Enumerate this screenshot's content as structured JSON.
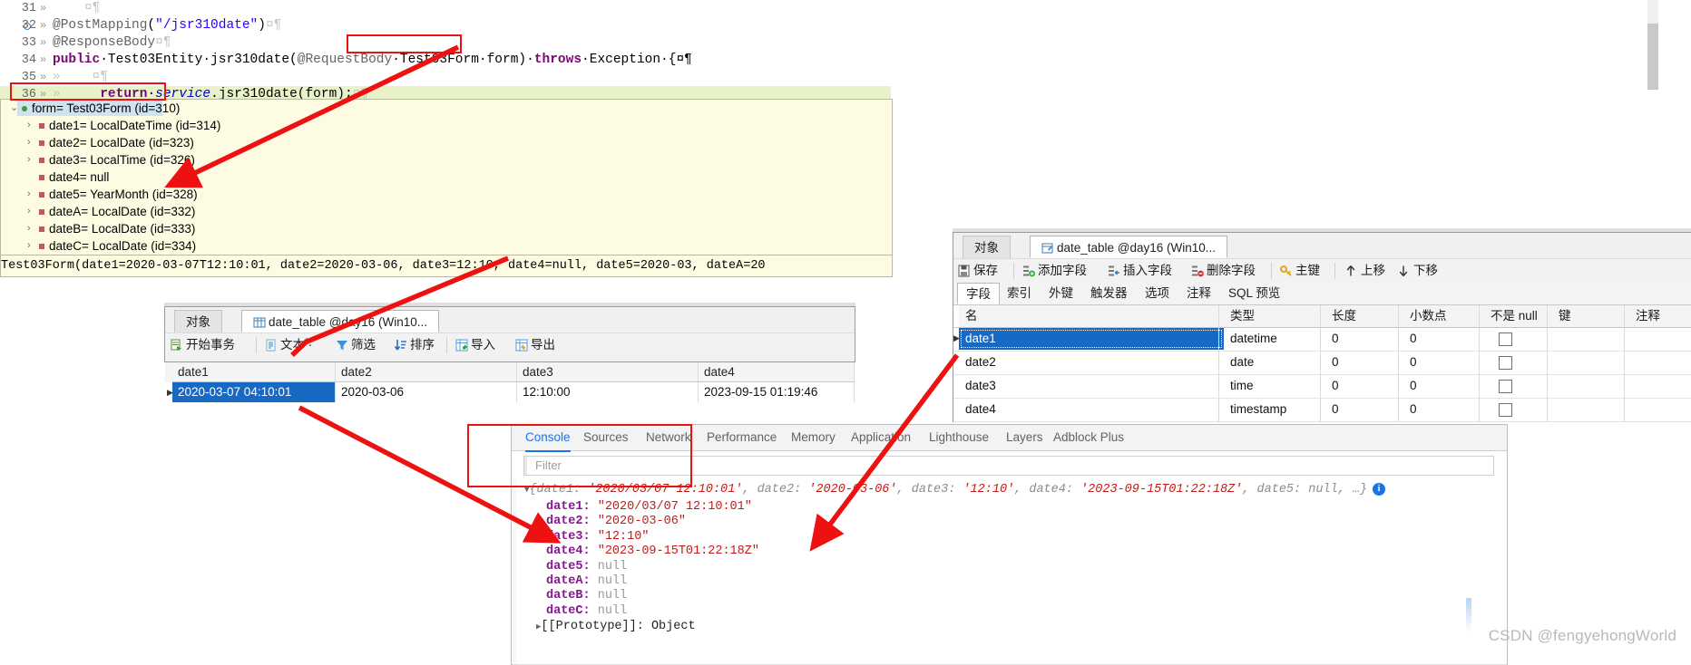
{
  "editor": {
    "lines": [
      {
        "num": "31",
        "fold": "»",
        "segments": [
          {
            "t": "    ",
            "c": "ws"
          },
          {
            "t": "¤¶",
            "c": "ws"
          }
        ]
      },
      {
        "num": "32",
        "fold": "»",
        "bp": true,
        "segments": [
          {
            "t": "@PostMapping",
            "c": "ann"
          },
          {
            "t": "(",
            "c": "typ"
          },
          {
            "t": "\"/jsr310date\"",
            "c": "str"
          },
          {
            "t": ")",
            "c": "typ"
          },
          {
            "t": "¤¶",
            "c": "ws"
          }
        ]
      },
      {
        "num": "33",
        "fold": "»",
        "segments": [
          {
            "t": "@ResponseBody",
            "c": "ann"
          },
          {
            "t": "¤¶",
            "c": "ws"
          }
        ]
      },
      {
        "num": "34",
        "fold": "»",
        "segments": [
          {
            "t": "public",
            "c": "kw"
          },
          {
            "t": "·Test03Entity·jsr310date(",
            "c": "typ"
          },
          {
            "t": "@RequestBody",
            "c": "ann"
          },
          {
            "t": "·Test03Form·form)·",
            "c": "typ"
          },
          {
            "t": "throws",
            "c": "kw"
          },
          {
            "t": "·Exception·{¤¶",
            "c": "typ"
          }
        ]
      },
      {
        "num": "35",
        "fold": "»",
        "segments": [
          {
            "t": "»    ¤¶",
            "c": "ws"
          }
        ]
      },
      {
        "num": "36",
        "fold": "»",
        "hl": true,
        "segments": [
          {
            "t": "»     ",
            "c": "ws"
          },
          {
            "t": "return",
            "c": "kw"
          },
          {
            "t": "·",
            "c": "typ"
          },
          {
            "t": "service",
            "c": "fld"
          },
          {
            "t": ".jsr310date(form);",
            "c": "typ"
          },
          {
            "t": "¤¶",
            "c": "ws"
          }
        ]
      }
    ],
    "highlight_box_label": "Test03Form form"
  },
  "tooltip": {
    "rows": [
      {
        "indent": 0,
        "twisty": "v",
        "bullet": "obj",
        "text": "form= Test03Form  (id=310)",
        "selected": true
      },
      {
        "indent": 1,
        "twisty": ">",
        "bullet": "field",
        "text": "date1= LocalDateTime  (id=314)"
      },
      {
        "indent": 1,
        "twisty": ">",
        "bullet": "field",
        "text": "date2= LocalDate  (id=323)"
      },
      {
        "indent": 1,
        "twisty": ">",
        "bullet": "field",
        "text": "date3= LocalTime  (id=326)"
      },
      {
        "indent": 1,
        "twisty": "",
        "bullet": "field",
        "text": "date4= null"
      },
      {
        "indent": 1,
        "twisty": ">",
        "bullet": "field",
        "text": "date5= YearMonth  (id=328)"
      },
      {
        "indent": 1,
        "twisty": ">",
        "bullet": "field",
        "text": "dateA= LocalDate  (id=332)"
      },
      {
        "indent": 1,
        "twisty": ">",
        "bullet": "field",
        "text": "dateB= LocalDate  (id=333)"
      },
      {
        "indent": 1,
        "twisty": ">",
        "bullet": "field",
        "text": "dateC= LocalDate  (id=334)"
      }
    ],
    "status": "Test03Form(date1=2020-03-07T12:10:01, date2=2020-03-06, date3=12:10, date4=null, date5=2020-03, dateA=20"
  },
  "navicat_data": {
    "tabs": [
      {
        "label": "对象",
        "active": false,
        "icon": "none"
      },
      {
        "label": "date_table @day16 (Win10...",
        "active": true,
        "icon": "grid-icon"
      }
    ],
    "toolbar": [
      {
        "label": "开始事务",
        "icon": "transaction-icon"
      },
      {
        "label": "文本",
        "icon": "text-icon",
        "caret": "·"
      },
      {
        "label": "筛选",
        "icon": "filter-icon"
      },
      {
        "label": "排序",
        "icon": "sort-icon"
      },
      {
        "label": "导入",
        "icon": "import-icon"
      },
      {
        "label": "导出",
        "icon": "export-icon"
      }
    ],
    "columns": [
      "date1",
      "date2",
      "date3",
      "date4"
    ],
    "rows": [
      [
        "2020-03-07 04:10:01",
        "2020-03-06",
        "12:10:00",
        "2023-09-15 01:19:46"
      ]
    ]
  },
  "navicat_struct": {
    "tabs": [
      {
        "label": "对象",
        "active": false,
        "icon": "none"
      },
      {
        "label": "date_table @day16 (Win10...",
        "active": true,
        "icon": "table-design-icon"
      }
    ],
    "toolbar": [
      {
        "label": "保存",
        "icon": "save-icon"
      },
      {
        "label": "添加字段",
        "icon": "add-field-icon"
      },
      {
        "label": "插入字段",
        "icon": "insert-field-icon"
      },
      {
        "label": "删除字段",
        "icon": "delete-field-icon"
      },
      {
        "label": "主键",
        "icon": "primary-key-icon"
      },
      {
        "label": "上移",
        "icon": "arrow-up-icon"
      },
      {
        "label": "下移",
        "icon": "arrow-down-icon"
      }
    ],
    "subtabs": [
      "字段",
      "索引",
      "外键",
      "触发器",
      "选项",
      "注释",
      "SQL 预览"
    ],
    "active_subtab": "字段",
    "columns": [
      "名",
      "类型",
      "长度",
      "小数点",
      "不是 null",
      "键",
      "注释"
    ],
    "rows": [
      {
        "name": "date1",
        "type": "datetime",
        "length": "0",
        "decimals": "0",
        "notnull": false,
        "key": "",
        "comment": "",
        "selected": true
      },
      {
        "name": "date2",
        "type": "date",
        "length": "0",
        "decimals": "0",
        "notnull": false,
        "key": "",
        "comment": "",
        "selected": false
      },
      {
        "name": "date3",
        "type": "time",
        "length": "0",
        "decimals": "0",
        "notnull": false,
        "key": "",
        "comment": "",
        "selected": false
      },
      {
        "name": "date4",
        "type": "timestamp",
        "length": "0",
        "decimals": "0",
        "notnull": false,
        "key": "",
        "comment": "",
        "selected": false
      }
    ]
  },
  "devtools": {
    "tabs": [
      "Console",
      "Sources",
      "Network",
      "Performance",
      "Memory",
      "Application",
      "Lighthouse",
      "Layers",
      "Adblock Plus"
    ],
    "active_tab": "Console",
    "filter_placeholder": "Filter",
    "console": {
      "summary_prefix": "{",
      "summary": "date1: '2020/03/07 12:10:01', date2: '2020-03-06', date3: '12:10', date4: '2023-09-15T01:22:18Z', date5: null, …}",
      "entries": [
        {
          "key": "date1",
          "value": "\"2020/03/07 12:10:01\"",
          "type": "string"
        },
        {
          "key": "date2",
          "value": "\"2020-03-06\"",
          "type": "string"
        },
        {
          "key": "date3",
          "value": "\"12:10\"",
          "type": "string"
        },
        {
          "key": "date4",
          "value": "\"2023-09-15T01:22:18Z\"",
          "type": "string"
        },
        {
          "key": "date5",
          "value": "null",
          "type": "null"
        },
        {
          "key": "dateA",
          "value": "null",
          "type": "null"
        },
        {
          "key": "dateB",
          "value": "null",
          "type": "null"
        },
        {
          "key": "dateC",
          "value": "null",
          "type": "null"
        }
      ],
      "prototype_label": "[[Prototype]]: Object"
    }
  },
  "watermark": "CSDN @fengyehongWorld",
  "colors": {
    "annotation_red": "#ee1111",
    "selection_blue": "#1769c4",
    "devtools_accent": "#1a73e8",
    "tooltip_bg": "#fdfce2",
    "console_string": "#c41a16",
    "console_key": "#881391"
  }
}
